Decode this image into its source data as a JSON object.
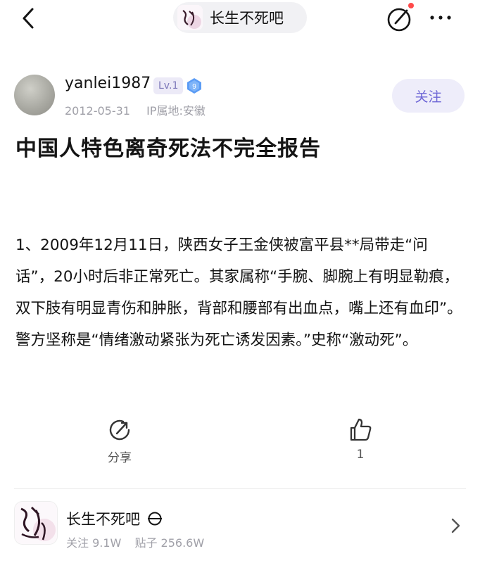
{
  "topbar": {
    "forum_name": "长生不死吧",
    "back_icon": "chevron-left-icon",
    "edit_icon": "compose-icon",
    "more_icon": "more-icon",
    "notification_dot_color": "#ff4a4a"
  },
  "author": {
    "name": "yanlei1987",
    "level": "Lv.1",
    "gem_level": "9",
    "date": "2012-05-31",
    "ip_location": "IP属地:安徽",
    "follow_label": "关注"
  },
  "post": {
    "title": "中国人特色离奇死法不完全报告",
    "body": "1、2009年12月11日，陕西女子王金侠被富平县**局带走“问话”，20小时后非正常死亡。其家属称“手腕、脚腕上有明显勒痕，双下肢有明显青伤和肿胀，背部和腰部有出血点，嘴上还有血印”。警方坚称是“情绪激动紧张为死亡诱发因素。”史称“激动死”。"
  },
  "actions": {
    "share_label": "分享",
    "like_count": "1"
  },
  "forum_card": {
    "name": "长生不死吧",
    "followers": "关注 9.1W",
    "posts": "贴子 256.6W"
  },
  "colors": {
    "accent": "#6e66d6",
    "follow_bg": "#eeedfa",
    "gem": "#5b9cf5",
    "muted": "#a0a0a8"
  }
}
